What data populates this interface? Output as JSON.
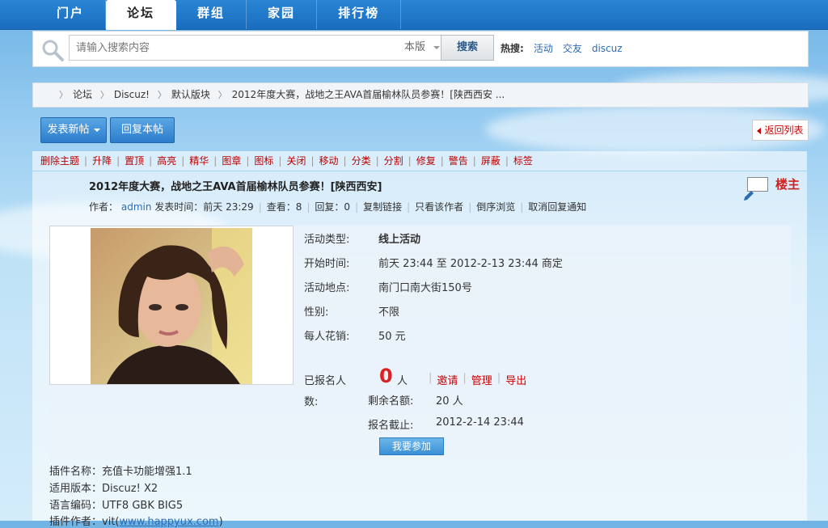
{
  "nav": {
    "tabs": [
      "门户",
      "论坛",
      "群组",
      "家园",
      "排行榜"
    ],
    "active": "论坛"
  },
  "search": {
    "placeholder": "请输入搜索内容",
    "scope": "本版",
    "button": "搜索",
    "hot_label": "热搜:",
    "hot_items": [
      "活动",
      "交友",
      "discuz"
    ]
  },
  "breadcrumb": [
    "论坛",
    "Discuz!",
    "默认版块",
    "2012年度大赛，战地之王AVA首届榆林队员参赛！[陕西西安 ..."
  ],
  "actions": {
    "new_post": "发表新帖",
    "reply": "回复本帖",
    "back": "返回列表"
  },
  "mod_actions": [
    "删除主题",
    "升降",
    "置顶",
    "高亮",
    "精华",
    "图章",
    "图标",
    "关闭",
    "移动",
    "分类",
    "分割",
    "修复",
    "警告",
    "屏蔽",
    "标签"
  ],
  "post": {
    "title": "2012年度大赛，战地之王AVA首届榆林队员参赛！[陕西西安]",
    "floor_label": "楼主",
    "author_label": "作者：",
    "author": "admin",
    "posted": "发表时间：前天 23:29",
    "views": "查看：8",
    "replies": "回复：0",
    "meta_links": [
      "复制链接",
      "只看该作者",
      "倒序浏览",
      "取消回复通知"
    ]
  },
  "activity": {
    "rows": [
      {
        "k": "活动类型:",
        "v": "线上活动"
      },
      {
        "k": "开始时间:",
        "v": "前天 23:44 至  2012-2-13 23:44 商定"
      },
      {
        "k": "活动地点:",
        "v": "南门口南大街150号"
      },
      {
        "k": "性别:",
        "v": "不限"
      },
      {
        "k": "每人花销:",
        "v": "50 元"
      }
    ],
    "signed_label": "已报名人数:",
    "signed_count": "0",
    "signed_unit": "人",
    "links": [
      "邀请",
      "管理",
      "导出"
    ],
    "remaining_label": "剩余名额:",
    "remaining_value": "20 人",
    "deadline_label": "报名截止:",
    "deadline_value": "2012-2-14 23:44",
    "join_button": "我要参加"
  },
  "plugin": {
    "name": "插件名称：充值卡功能增强1.1",
    "version": "适用版本：Discuz! X2",
    "encoding": "语言编码：UTF8 GBK BIG5",
    "author_prefix": "插件作者：",
    "author_name": "vit(",
    "author_link": "www.happyux.com",
    "author_suffix": ")"
  }
}
